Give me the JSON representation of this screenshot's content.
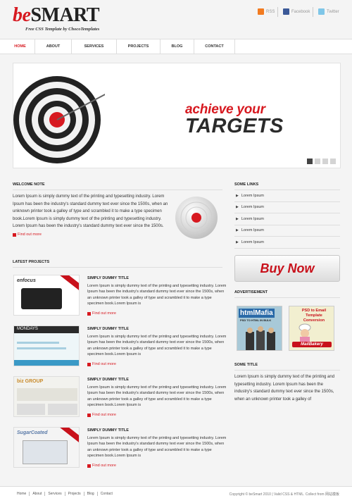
{
  "header": {
    "logo_be": "be",
    "logo_smart": "SMART",
    "tagline": "Free CSS Template by ChocoTemplates",
    "social": [
      {
        "label": "RSS",
        "icon": "rss-icon"
      },
      {
        "label": "Facebook",
        "icon": "facebook-icon"
      },
      {
        "label": "Twitter",
        "icon": "twitter-icon"
      }
    ]
  },
  "nav": [
    "HOME",
    "ABOUT",
    "SERVICES",
    "PROJECTS",
    "BLOG",
    "CONTACT"
  ],
  "slider": {
    "line1": "achieve your",
    "line2": "TARGETS",
    "slides": 4,
    "active_slide": 1
  },
  "welcome": {
    "title": "WELCOME NOTE",
    "text": "Lorem Ipsum is simply dummy text of the printing and typesetting industry. Lorem Ipsum has been the industry's standard dummy text ever since the 1500s, when an unknown printer took a galley of type and scrambled it to make a type specimen book.Lorem Ipsum is simply dummy text of the printing and typesetting industry. Lorem Ipsum has been the industry's standard dummy text ever since the 1500s.",
    "more": "Find out more"
  },
  "some_links": {
    "title": "SOME LINKS",
    "items": [
      "Lorem Ipsum",
      "Lorem Ipsum",
      "Lorem Ipsum",
      "Lorem Ipsum",
      "Lorem Ipsum"
    ]
  },
  "buy_now": "Buy Now",
  "advertisement": {
    "title": "ADVERTISEMENT",
    "ad1_title": "htmlMafia",
    "ad1_sub": "PSD TO HTML IN BULK",
    "ad2_title": "PSD to Email Template Conversion",
    "ad2_sub": "MailBakery"
  },
  "some_title": {
    "title": "SOME TITLE",
    "text": "Lorem Ipsum is simply dummy text of the printing and typesetting industry. Lorem Ipsum has been the industry's standard dummy text ever since the 1500s, when an unknown printer took a galley of"
  },
  "projects": {
    "title": "LATEST PROJECTS",
    "items": [
      {
        "title": "SIMPLY DUMMY TITLE",
        "text": "Lorem Ipsum is simply dummy text of the printing and typesetting industry. Lorem Ipsum has been the industry's standard dummy text ever since the 1500s, when an unknown printer took a galley of type and scrambled it to make a type specimen book.Lorem Ipsum is",
        "more": "Find out more",
        "thumb_text": "enfocus"
      },
      {
        "title": "SIMPLY DUMMY TITLE",
        "text": "Lorem Ipsum is simply dummy text of the printing and typesetting industry. Lorem Ipsum has been the industry's standard dummy text ever since the 1500s, when an unknown printer took a galley of type and scrambled it to make a type specimen book.Lorem Ipsum is",
        "more": "Find out more",
        "thumb_text": "MONDAYS"
      },
      {
        "title": "SIMPLY DUMMY TITLE",
        "text": "Lorem Ipsum is simply dummy text of the printing and typesetting industry. Lorem Ipsum has been the industry's standard dummy text ever since the 1500s, when an unknown printer took a galley of type and scrambled it to make a type specimen book.Lorem Ipsum is",
        "more": "Find out more",
        "thumb_text": "biz GROUP"
      },
      {
        "title": "SIMPLY DUMMY TITLE",
        "text": "Lorem Ipsum is simply dummy text of the printing and typesetting industry. Lorem Ipsum has been the industry's standard dummy text ever since the 1500s, when an unknown printer took a galley of type and scrambled it to make a type specimen book.Lorem Ipsum is",
        "more": "Find out more",
        "thumb_text": "SugarCoated"
      }
    ]
  },
  "footer": {
    "links": [
      "Home",
      "About",
      "Services",
      "Projects",
      "Blog",
      "Contact"
    ],
    "copyright": "Copyright © beSmart 2010 | Valid CSS & HTML. Collect from 网站模板"
  }
}
